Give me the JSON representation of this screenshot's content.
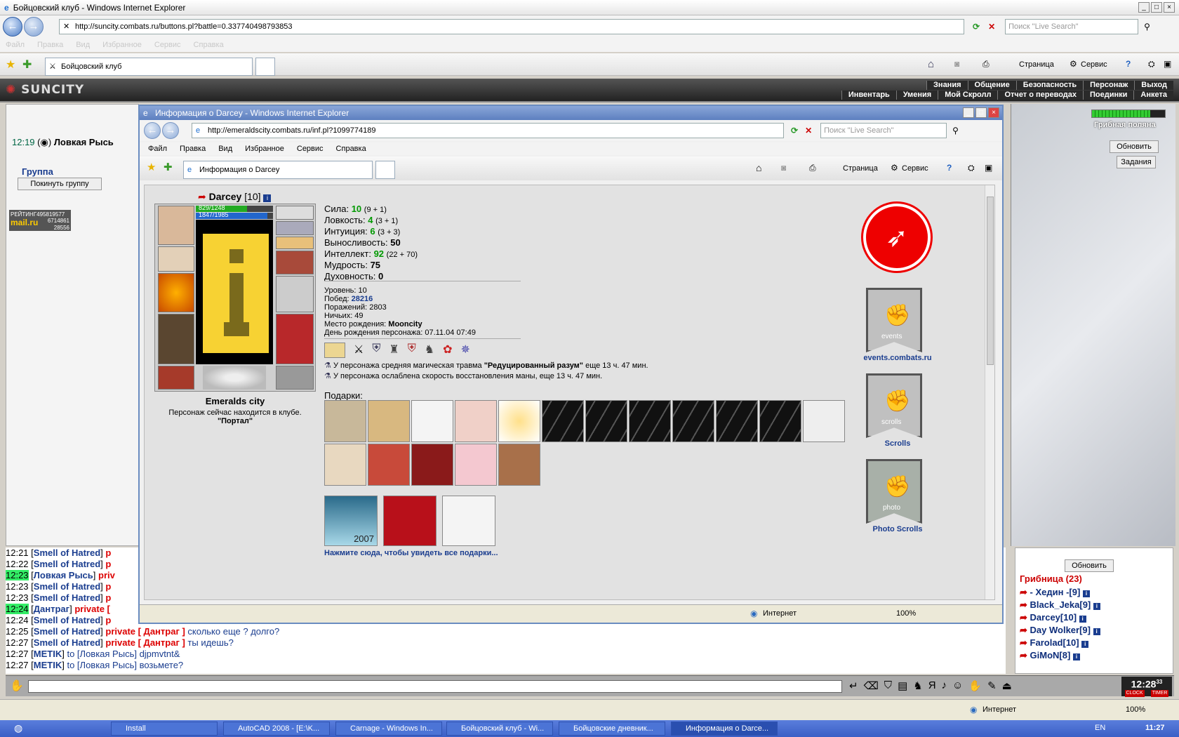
{
  "main_window": {
    "title": "Бойцовский клуб - Windows Internet Explorer",
    "url": "http://suncity.combats.ru/buttons.pl?battle=0.337740498793853",
    "search_placeholder": "Поиск \"Live Search\"",
    "menu": [
      "Файл",
      "Правка",
      "Вид",
      "Избранное",
      "Сервис",
      "Справка"
    ],
    "tab_label": "Бойцовский клуб",
    "toolbar": {
      "page": "Страница",
      "service": "Сервис"
    }
  },
  "game": {
    "logo": "SUNCITY",
    "menu_row1": [
      "Знания",
      "Общение",
      "Безопасность",
      "Персонаж",
      "Выход"
    ],
    "menu_row2": [
      "Инвентарь",
      "Умения",
      "Мой Скролл",
      "Отчет о переводах",
      "Поединки",
      "Анкета"
    ],
    "left": {
      "time": "12:19",
      "player": "Ловкая Рысь",
      "group_title": "Группа",
      "leave_group": "Покинуть группу",
      "rating_label": "РЕЙТИНГ",
      "rating_num1": "495819577",
      "rating_num2": "6714861",
      "rating_num3": "28556",
      "mailru": "mail.ru"
    },
    "right": {
      "location": "Грибная поляна",
      "refresh": "Обновить",
      "tasks": "Задания"
    },
    "chat": [
      {
        "t": "12:21",
        "hl": false,
        "nick": "Smell of Hatred",
        "priv": "p",
        "msg": ""
      },
      {
        "t": "12:22",
        "hl": false,
        "nick": "Smell of Hatred",
        "priv": "p",
        "msg": ""
      },
      {
        "t": "12:23",
        "hl": true,
        "nick": "Ловкая Рысь",
        "priv": "priv",
        "msg": ""
      },
      {
        "t": "12:23",
        "hl": false,
        "nick": "Smell of Hatred",
        "priv": "p",
        "msg": ""
      },
      {
        "t": "12:23",
        "hl": false,
        "nick": "Smell of Hatred",
        "priv": "p",
        "msg": ""
      },
      {
        "t": "12:24",
        "hl": true,
        "nick": "Дантраг",
        "priv": "private [",
        "msg": ""
      },
      {
        "t": "12:24",
        "hl": false,
        "nick": "Smell of Hatred",
        "priv": "p",
        "msg": ""
      },
      {
        "t": "12:25",
        "hl": false,
        "nick": "Smell of Hatred",
        "priv": "private [ Дантраг ]",
        "msg": "сколько еще ? долго?"
      },
      {
        "t": "12:27",
        "hl": false,
        "nick": "Smell of Hatred",
        "priv": "private [ Дантраг ]",
        "msg": "ты идешь?"
      },
      {
        "t": "12:27",
        "hl": false,
        "nick": "METIK",
        "priv": "",
        "msg": "to [Ловкая Рысь] djpmvtnt&"
      },
      {
        "t": "12:27",
        "hl": false,
        "nick": "METIK",
        "priv": "",
        "msg": "to [Ловкая Рысь] возьмете?"
      }
    ],
    "online": {
      "refresh": "Обновить",
      "room": "Грибница (23)",
      "users": [
        "- Хедин -[9]",
        "Black_Jeka[9]",
        "Darcey[10]",
        "Day Wolker[9]",
        "Farolad[10]",
        "GiMoN[8]"
      ]
    },
    "clock": "12:28",
    "clock_sec": "33",
    "clock_lbl": "CLOCK",
    "timer_lbl": "TIMER"
  },
  "popup": {
    "title": "Информация о Darcey - Windows Internet Explorer",
    "url": "http://emeraldscity.combats.ru/inf.pl?1099774189",
    "search_placeholder": "Поиск \"Live Search\"",
    "menu": [
      "Файл",
      "Правка",
      "Вид",
      "Избранное",
      "Сервис",
      "Справка"
    ],
    "tab_label": "Информация о Darcey",
    "toolbar": {
      "page": "Страница",
      "service": "Сервис"
    },
    "status": {
      "zone": "Интернет",
      "zoom": "100%"
    }
  },
  "character": {
    "name": "Darcey",
    "level_tag": "[10]",
    "hp": "829/1248",
    "mana": "1847/1985",
    "hp_fraction": 0.66,
    "mana_fraction": 0.93,
    "city": "Emeralds city",
    "presence": "Персонаж сейчас находится в клубе.",
    "room": "\"Портал\"",
    "stats": [
      {
        "name": "Сила:",
        "value": "10",
        "extra": "(9 + 1)"
      },
      {
        "name": "Ловкость:",
        "value": "4",
        "extra": "(3 + 1)"
      },
      {
        "name": "Интуиция:",
        "value": "6",
        "extra": "(3 + 3)"
      },
      {
        "name": "Выносливость:",
        "value": "50",
        "extra": ""
      },
      {
        "name": "Интеллект:",
        "value": "92",
        "extra": "(22 + 70)"
      },
      {
        "name": "Мудрость:",
        "value": "75",
        "extra": ""
      },
      {
        "name": "Духовность:",
        "value": "0",
        "extra": ""
      }
    ],
    "info": {
      "level": "Уровень: 10",
      "wins_label": "Побед:",
      "wins": "28216",
      "losses": "Поражений: 2803",
      "draws": "Ничьих: 49",
      "birthplace_label": "Место рождения:",
      "birthplace": "Mooncity",
      "birthday": "День рождения персонажа: 07.11.04 07:49"
    },
    "effects": [
      {
        "pre": "У персонажа средняя магическая травма ",
        "bold": "\"Редуцированный разум\"",
        "post": " еще 13 ч. 47 мин."
      },
      {
        "pre": "У персонажа ослаблена скорость восстановления маны, еще 13 ч. 47 мин.",
        "bold": "",
        "post": ""
      }
    ],
    "gifts_title": "Подарки:",
    "gifts_all": "Нажмите сюда, чтобы увидеть все подарки...",
    "card_year": "2007",
    "banners": [
      "events.combats.ru",
      "Scrolls",
      "Photo Scrolls"
    ],
    "banner_words": [
      "events",
      "scrolls",
      "photo"
    ]
  },
  "taskbar": {
    "items": [
      "Install",
      "AutoCAD 2008 - [E:\\K...",
      "Carnage - Windows In...",
      "Бойцовский клуб - Wi...",
      "Бойцовские дневник...",
      "Информация о Darce..."
    ],
    "lang": "EN",
    "time": "11:27"
  },
  "main_status": {
    "zone": "Интернет",
    "zoom": "100%"
  },
  "colors": {
    "accent": "#1a3d8f",
    "private": "#dd0000",
    "highlight": "#33ee66",
    "stat_value": "#009900"
  }
}
